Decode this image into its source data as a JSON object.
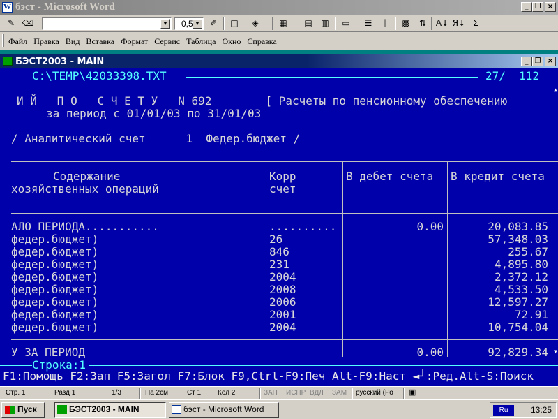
{
  "word": {
    "title": "бэст - Microsoft Word",
    "line_weight": "0,5",
    "menu": [
      "Файл",
      "Правка",
      "Вид",
      "Вставка",
      "Формат",
      "Сервис",
      "Таблица",
      "Окно",
      "Справка"
    ]
  },
  "dos": {
    "title": "БЭСТ2003 - MAIN",
    "file_path": "C:\\TEMP\\42033398.TXT",
    "line_position": "27/  112",
    "line1": "И Й   П О   С Ч Е Т У   N 692        [ Расчеты по пенсионному обеспечению",
    "line2": "за период с 01/01/03 по 31/01/03",
    "line3": "/ Аналитический счет      1  Федер.бюджет /",
    "headers": {
      "content_line1": "Содержание",
      "content_line2": "хозяйственных операций",
      "corr_line1": "Корр",
      "corr_line2": "счет",
      "debit": "В дебет счета",
      "credit": "В кредит счета"
    },
    "opening_row": {
      "label": "АЛО ПЕРИОДА...........",
      "corr": "..........",
      "debit": "0.00",
      "credit": "20,083.85"
    },
    "rows": [
      {
        "label": "федер.бюджет)",
        "corr": "26",
        "credit": "57,348.03"
      },
      {
        "label": "федер.бюджет)",
        "corr": "846",
        "credit": "255.67"
      },
      {
        "label": "федер.бюджет)",
        "corr": "231",
        "credit": "4,895.80"
      },
      {
        "label": "федер.бюджет)",
        "corr": "2004",
        "credit": "2,372.12"
      },
      {
        "label": "федер.бюджет)",
        "corr": "2008",
        "credit": "4,533.50"
      },
      {
        "label": "федер.бюджет)",
        "corr": "2006",
        "credit": "12,597.27"
      },
      {
        "label": "федер.бюджет)",
        "corr": "2001",
        "credit": "72.91"
      },
      {
        "label": "федер.бюджет)",
        "corr": "2004",
        "credit": "10,754.04"
      }
    ],
    "total_row": {
      "label": "У ЗА ПЕРИОД",
      "debit": "0.00",
      "credit": "92,829.34"
    },
    "status_line": "Строка:1",
    "fkeys": "F1:Помощь F2:Зап F5:Загол F7:Блок F9,Ctrl-F9:Печ Alt-F9:Наст ◄┘:Ред.Alt-S:Поиск"
  },
  "statusbar": {
    "page": "Стр. 1",
    "section": "Разд 1",
    "pages": "1/3",
    "at": "На 2см",
    "line": "Ст 1",
    "col": "Кол 2",
    "rec": "ЗАП",
    "trk": "ИСПР",
    "ext": "ВДЛ",
    "ovr": "ЗАМ",
    "lang": "русский (Ро"
  },
  "taskbar": {
    "start": "Пуск",
    "task1": "БЭСТ2003 - MAIN",
    "task2": "бэст - Microsoft Word",
    "lang": "Ru",
    "clock": "13:25"
  },
  "colors": {
    "console_bg": "#0000aa",
    "console_text": "#d8d8d8",
    "console_accent": "#55ffff",
    "title_active": "#0a246a",
    "title_inactive": "#808080"
  }
}
